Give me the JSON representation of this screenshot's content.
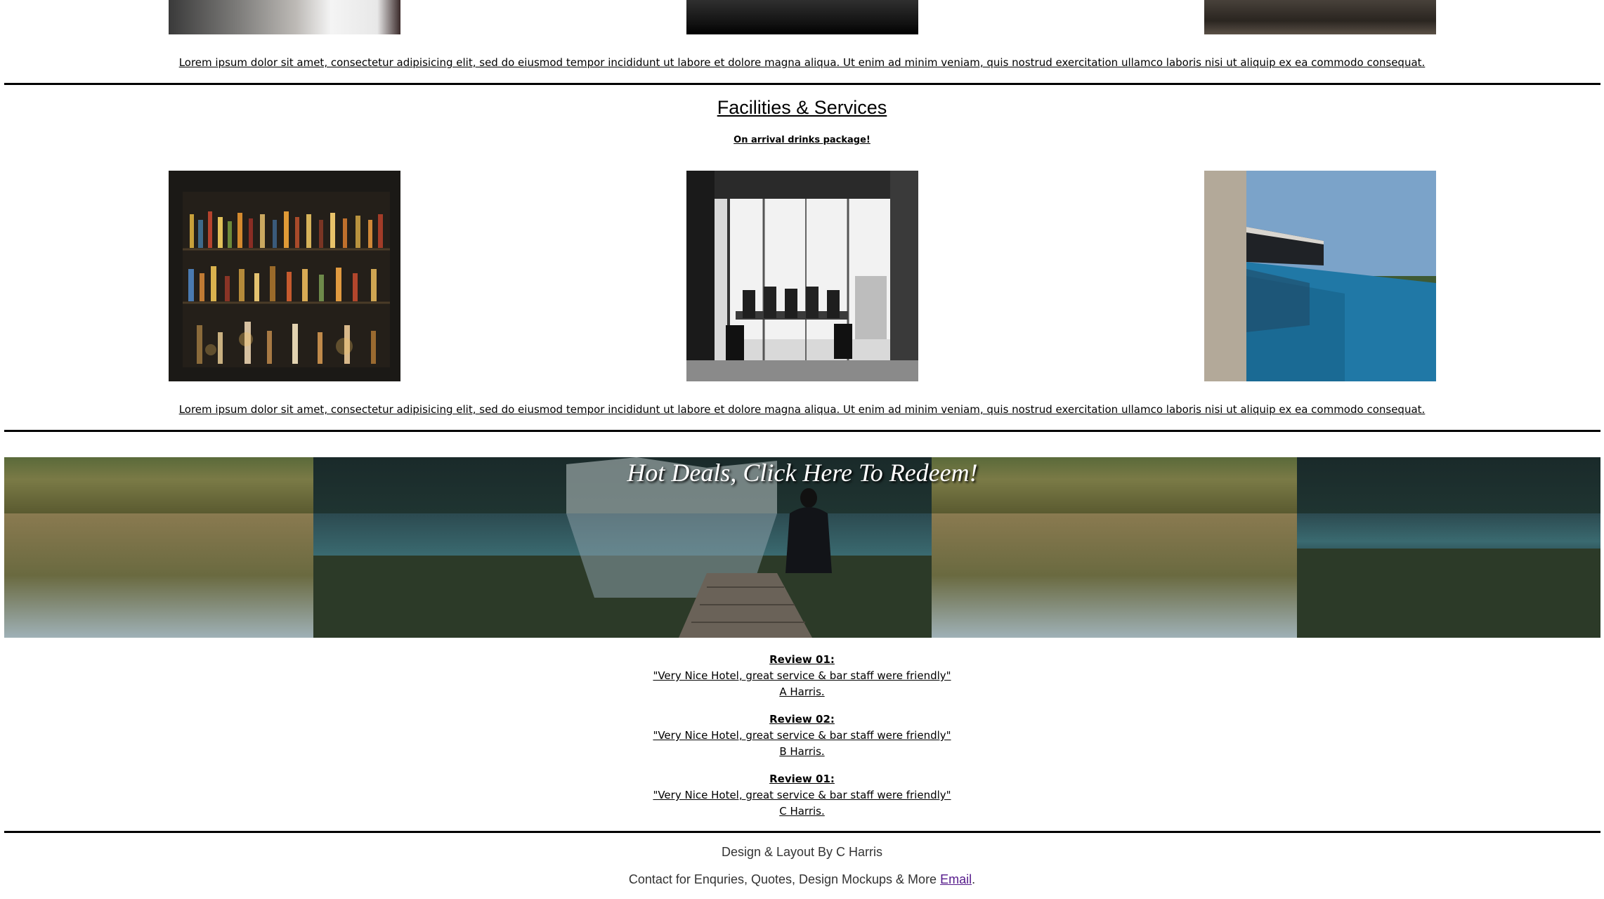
{
  "lorem_text": "Lorem ipsum dolor sit amet, consectetur adipisicing elit, sed do eiusmod tempor incididunt ut labore et dolore magna aliqua. Ut enim ad minim veniam, quis nostrud exercitation ullamco laboris nisi ut aliquip ex ea commodo consequat.",
  "facilities": {
    "title": "Facilities & Services",
    "subtitle": "On arrival drinks package!",
    "images": [
      "bar-shelves-image",
      "meeting-room-image",
      "infinity-pool-image"
    ]
  },
  "banner": {
    "title": "Hot Deals, Click Here To Redeem!"
  },
  "reviews": [
    {
      "title": "Review 01:",
      "quote": "\"Very Nice Hotel, great service & bar staff were friendly\"",
      "author": "A Harris."
    },
    {
      "title": "Review 02:",
      "quote": "\"Very Nice Hotel, great service & bar staff were friendly\"",
      "author": "B Harris."
    },
    {
      "title": "Review 01:",
      "quote": "\"Very Nice Hotel, great service & bar staff were friendly\"",
      "author": "C Harris."
    }
  ],
  "footer": {
    "credit": "Design & Layout By C Harris",
    "contact_text": "Contact for Enquries, Quotes, Design Mockups & More ",
    "email_link": "Email",
    "end": "."
  },
  "colors": {
    "link_visited": "#551a8b",
    "footer_text": "#333333"
  }
}
